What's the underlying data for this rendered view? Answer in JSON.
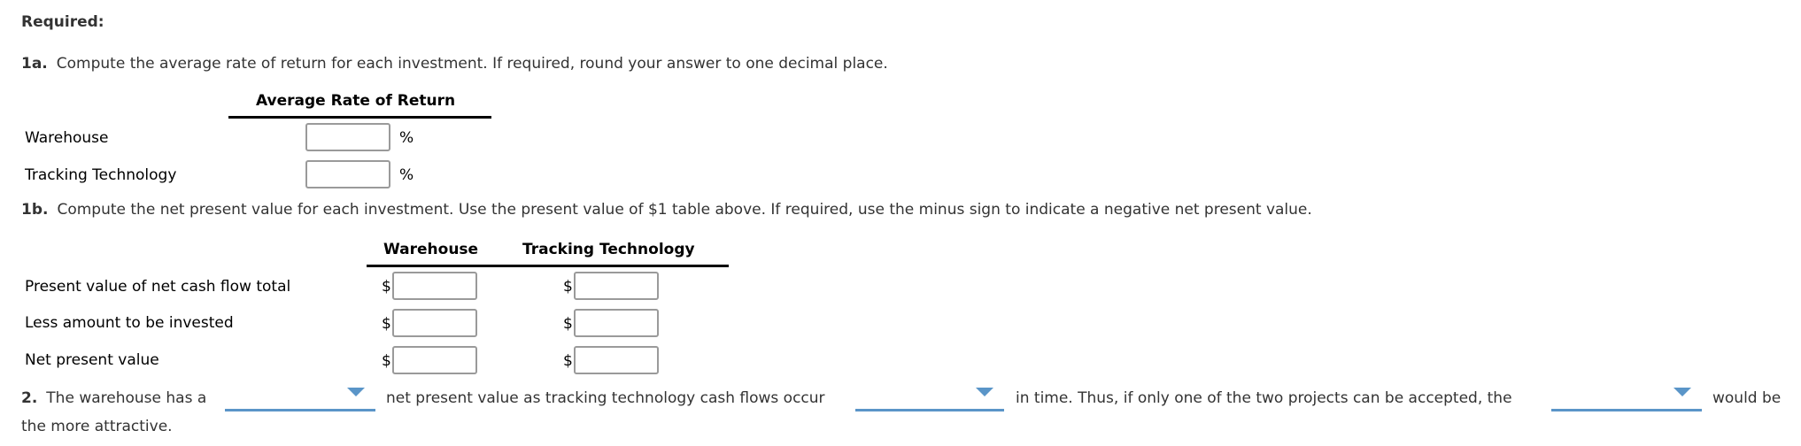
{
  "required_label": "Required:",
  "q1a": {
    "number": "1a.",
    "text": "Compute the average rate of return for each investment. If required, round your answer to one decimal place.",
    "column_header": "Average Rate of Return",
    "rows": [
      {
        "label": "Warehouse",
        "value": "",
        "unit": "%"
      },
      {
        "label": "Tracking Technology",
        "value": "",
        "unit": "%"
      }
    ]
  },
  "q1b": {
    "number": "1b.",
    "text": "Compute the net present value for each investment. Use the present value of $1 table above. If required, use the minus sign to indicate a negative net present value.",
    "columns": [
      "Warehouse",
      "Tracking Technology"
    ],
    "currency_symbol": "$",
    "rows": [
      {
        "label": "Present value of net cash flow total",
        "warehouse": "",
        "tracking": ""
      },
      {
        "label": "Less amount to be invested",
        "warehouse": "",
        "tracking": ""
      },
      {
        "label": "Net present value",
        "warehouse": "",
        "tracking": ""
      }
    ]
  },
  "q2": {
    "number": "2.",
    "text_1": "The warehouse has a",
    "text_2": "net present value as tracking technology cash flows occur",
    "text_3": "in time. Thus, if only one of the two projects can be accepted, the",
    "text_4": "would be",
    "text_5": "the more attractive.",
    "dropdowns": [
      {
        "selected": "",
        "icon": "dropdown-arrow-icon"
      },
      {
        "selected": "",
        "icon": "dropdown-arrow-icon"
      },
      {
        "selected": "",
        "icon": "dropdown-arrow-icon"
      }
    ]
  },
  "colors": {
    "dropdown_accent": "#5a95c8",
    "text": "#333333"
  }
}
